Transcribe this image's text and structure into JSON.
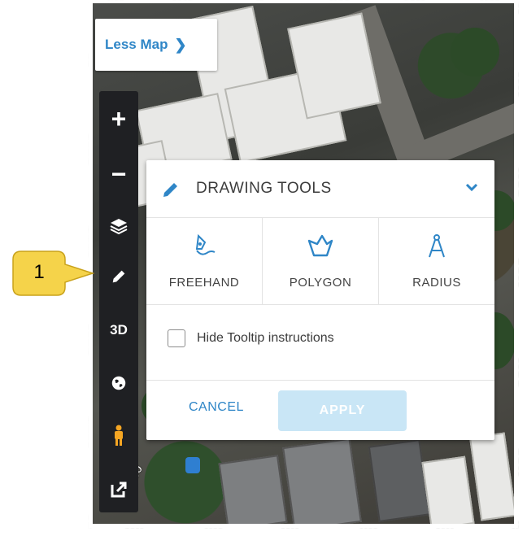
{
  "map_controls": {
    "less_map_label": "Less Map",
    "toolbar": {
      "zoom_in": "+",
      "zoom_out": "−",
      "three_d": "3D"
    }
  },
  "callout": {
    "number": "1"
  },
  "drawing_panel": {
    "title": "DRAWING TOOLS",
    "tools": [
      {
        "label": "FREEHAND",
        "icon": "pen-nib-icon"
      },
      {
        "label": "POLYGON",
        "icon": "polygon-icon"
      },
      {
        "label": "RADIUS",
        "icon": "compass-icon"
      }
    ],
    "hide_tooltip_label": "Hide Tooltip instructions",
    "hide_tooltip_checked": false,
    "cancel_label": "CANCEL",
    "apply_label": "APPLY"
  },
  "map": {
    "street_label": "ontego"
  },
  "colors": {
    "accent": "#2f86c7",
    "apply_disabled": "#c9e6f6",
    "toolbar_bg": "#1f2023",
    "callout_fill": "#f5d34a"
  }
}
